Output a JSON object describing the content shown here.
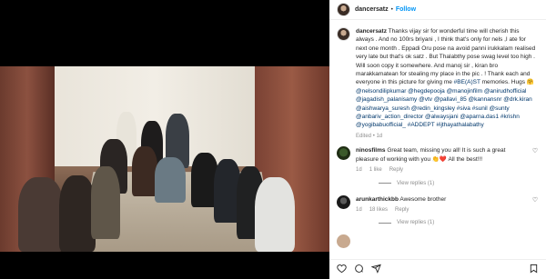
{
  "post": {
    "username": "dancersatz",
    "follow_separator": "•",
    "follow_label": "Follow",
    "caption_user": "dancersatz",
    "caption_text": "Thanks vijay sir for wonderful time will cherish this always . And no 100rs briyani , I think that's only for nels ,I ate for next one month . Eppadi Oru pose na avoid panni irukkalam realised very late but that's ok satz . But Thalabthy pose swag level too high . Will soon copy it somewhere. And manoj sir , kiran bro marakkamatean for stealing my place in the pic . ! Thank each and everyone in this picture for giving me",
    "hashtag_1": "#BE(A)ST",
    "caption_text_2": "memories. Hugs",
    "emoji_hug": "🤗",
    "mentions": "@nelsondilipkumar @hegdepooja @manojinfilm @anirudhofficial @jagadish_palanisamy @vtv @pallavi_85 @kannansnr @drk.kiran @aishwarya_suresh @redin_kingsley #siva #sunil @sunty @anbariv_action_director @alwaysjani @aparna.das1 #krishn @yogibabuofficial_ #ADDEPT #ijthayathalabathy",
    "edited_label": "Edited",
    "edited_separator": "•",
    "edited_time": "1d"
  },
  "comments": [
    {
      "user": "ninosfilms",
      "text": "Great team, missing you all! It is such a great pleasure of working with you",
      "emoji": "👏❤️",
      "text_end": "All the best!!!",
      "time": "1d",
      "likes": "1 like",
      "reply": "Reply",
      "view_replies": "View replies (1)"
    },
    {
      "user": "arunkarthickbb",
      "text": "Awesome brother",
      "time": "1d",
      "likes": "18 likes",
      "reply": "Reply",
      "view_replies": "View replies (1)"
    }
  ],
  "actions": {
    "like_icon": "heart-outline-icon",
    "comment_icon": "comment-icon",
    "share_icon": "paper-plane-icon",
    "save_icon": "bookmark-icon"
  },
  "colors": {
    "accent": "#0095f6",
    "mention": "#00376b",
    "muted": "#8e8e8e"
  }
}
